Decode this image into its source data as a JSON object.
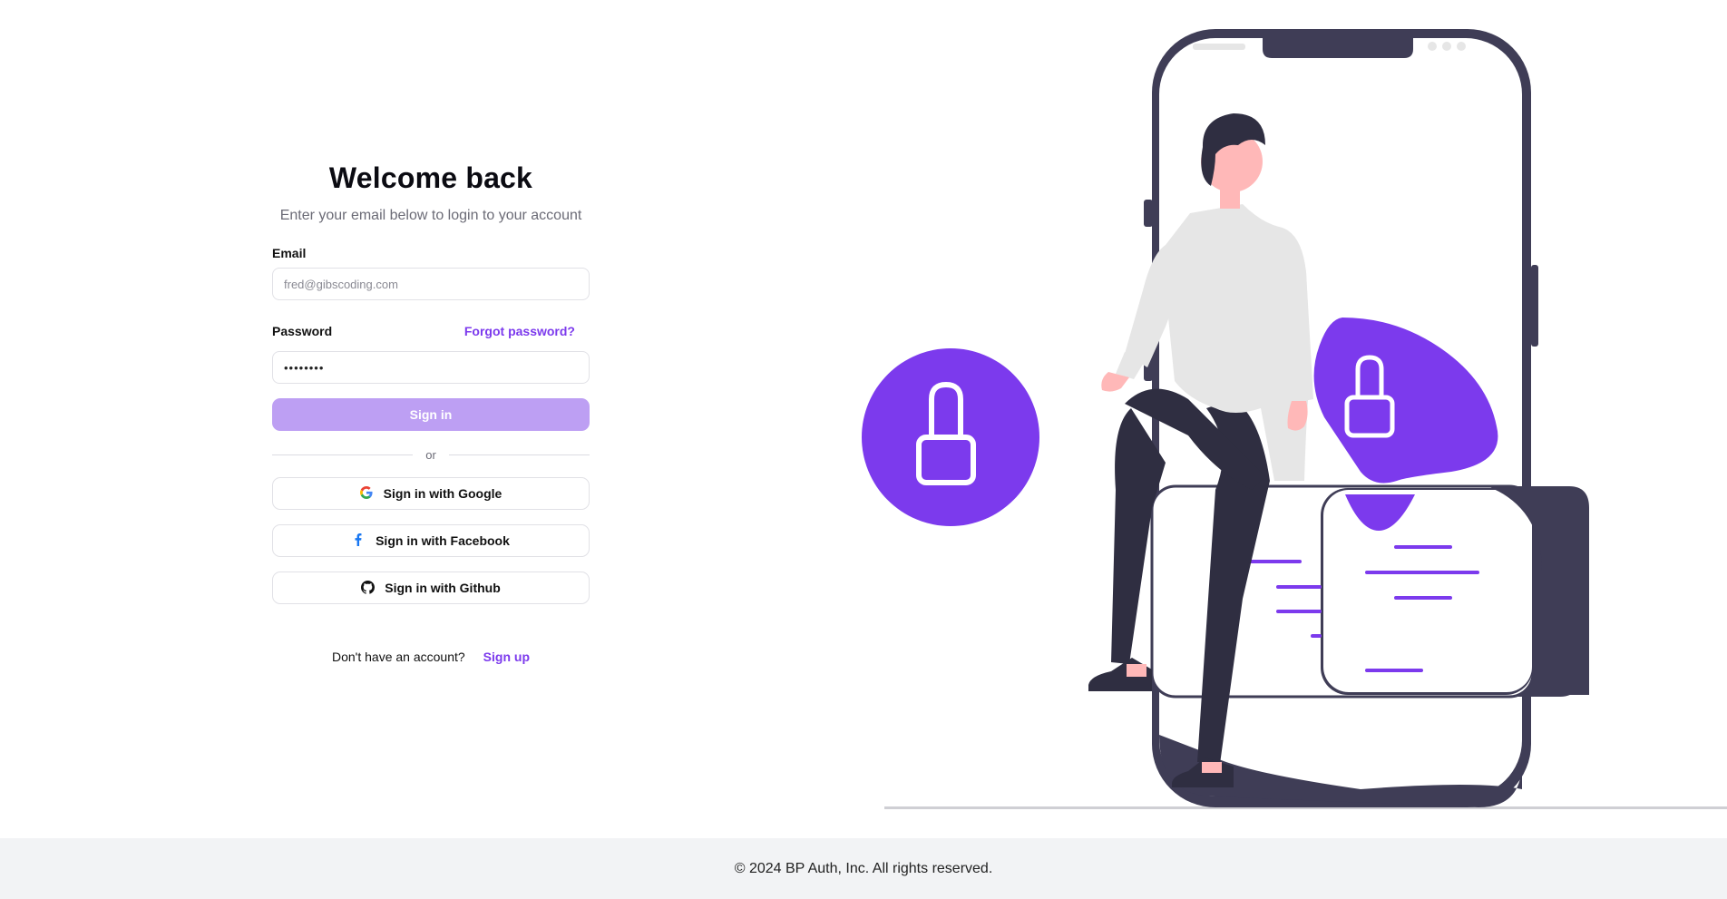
{
  "login": {
    "title": "Welcome back",
    "subtitle": "Enter your email below to login to your account",
    "email_label": "Email",
    "email_placeholder": "fred@gibscoding.com",
    "password_label": "Password",
    "forgot_link": "Forgot password?",
    "password_value": "password",
    "sign_in_button": "Sign in",
    "divider_text": "or",
    "google_button": "Sign in with Google",
    "facebook_button": "Sign in with Facebook",
    "github_button": "Sign in with Github",
    "no_account_text": "Don't have an account?",
    "sign_up_link": "Sign up"
  },
  "footer": {
    "copyright": "© 2024 BP Auth, Inc. All rights reserved."
  },
  "colors": {
    "accent": "#7c3aed",
    "button_disabled": "#bd9ff3",
    "dark": "#3f3d56",
    "footer_bg": "#f2f3f5"
  },
  "icons": {
    "google": "google-icon",
    "facebook": "facebook-icon",
    "github": "github-icon",
    "lock": "lock-icon"
  }
}
